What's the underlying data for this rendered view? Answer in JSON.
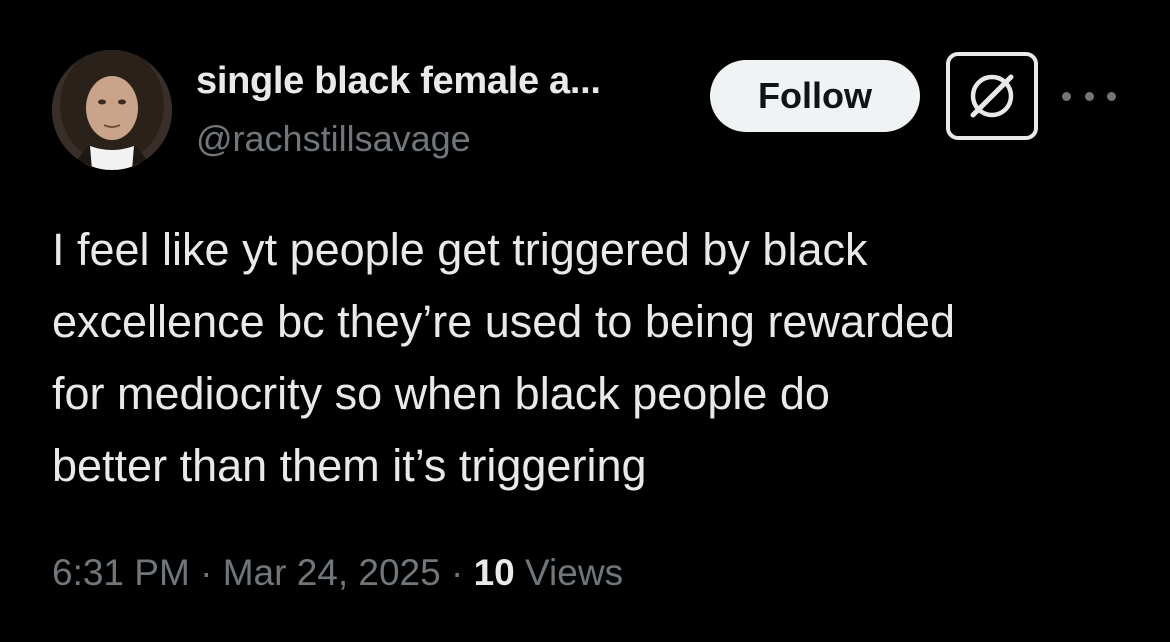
{
  "author": {
    "display_name": "single black female a...",
    "handle": "@rachstillsavage",
    "avatar_icon": "profile-photo"
  },
  "actions": {
    "follow_label": "Follow",
    "grok_icon": "grok-icon",
    "more_icon": "more-options-icon"
  },
  "tweet": {
    "text_lines": [
      "I feel like yt people get triggered by black",
      "excellence bc they’re used to being rewarded",
      "for mediocrity so when black people do",
      "better than them it’s triggering"
    ]
  },
  "meta": {
    "time": "6:31 PM",
    "separator": "·",
    "date": "Mar 24, 2025",
    "views_count": "10",
    "views_label": "Views"
  },
  "colors": {
    "background": "#000000",
    "primary_text": "#e7e9ea",
    "secondary_text": "#71767b",
    "follow_bg": "#eff3f4"
  }
}
